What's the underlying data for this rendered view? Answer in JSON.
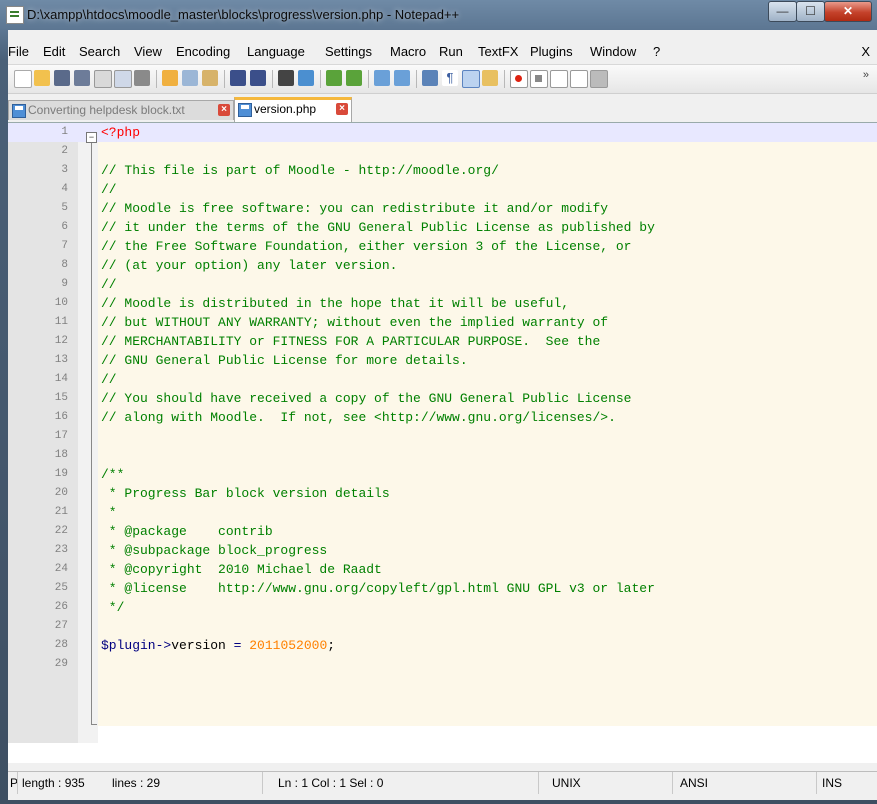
{
  "window": {
    "title": "D:\\xampp\\htdocs\\moodle_master\\blocks\\progress\\version.php - Notepad++",
    "min_glyph": "—",
    "max_glyph": "☐",
    "close_glyph": "✕"
  },
  "menu": {
    "items": [
      "File",
      "Edit",
      "Search",
      "View",
      "Encoding",
      "Language",
      "Settings",
      "Macro",
      "Run",
      "TextFX",
      "Plugins",
      "Window",
      "?"
    ],
    "close_glyph": "X"
  },
  "toolbar": {
    "icons": [
      "new-file-icon",
      "open-file-icon",
      "save-icon",
      "save-all-icon",
      "close-icon",
      "close-all-icon",
      "print-icon",
      "cut-icon",
      "copy-icon",
      "paste-icon",
      "undo-icon",
      "redo-icon",
      "find-icon",
      "replace-icon",
      "zoom-in-icon",
      "zoom-out-icon",
      "sync-v-icon",
      "sync-h-icon",
      "word-wrap-icon",
      "show-all-chars-icon",
      "indent-guide-icon",
      "doc-map-icon",
      "record-macro-icon",
      "stop-macro-icon",
      "play-macro-icon",
      "run-macro-multiple-icon",
      "save-macro-icon"
    ],
    "more_glyph": "»"
  },
  "tabs": [
    {
      "label": "Converting helpdesk block.txt",
      "active": false
    },
    {
      "label": "version.php",
      "active": true
    }
  ],
  "editor": {
    "lines": [
      {
        "n": "1",
        "t": "<?php"
      },
      {
        "n": "2",
        "t": ""
      },
      {
        "n": "3",
        "t": "// This file is part of Moodle - http://moodle.org/"
      },
      {
        "n": "4",
        "t": "//"
      },
      {
        "n": "5",
        "t": "// Moodle is free software: you can redistribute it and/or modify"
      },
      {
        "n": "6",
        "t": "// it under the terms of the GNU General Public License as published by"
      },
      {
        "n": "7",
        "t": "// the Free Software Foundation, either version 3 of the License, or"
      },
      {
        "n": "8",
        "t": "// (at your option) any later version."
      },
      {
        "n": "9",
        "t": "//"
      },
      {
        "n": "10",
        "t": "// Moodle is distributed in the hope that it will be useful,"
      },
      {
        "n": "11",
        "t": "// but WITHOUT ANY WARRANTY; without even the implied warranty of"
      },
      {
        "n": "12",
        "t": "// MERCHANTABILITY or FITNESS FOR A PARTICULAR PURPOSE.  See the"
      },
      {
        "n": "13",
        "t": "// GNU General Public License for more details."
      },
      {
        "n": "14",
        "t": "//"
      },
      {
        "n": "15",
        "t": "// You should have received a copy of the GNU General Public License"
      },
      {
        "n": "16",
        "t": "// along with Moodle.  If not, see <http://www.gnu.org/licenses/>."
      },
      {
        "n": "17",
        "t": ""
      },
      {
        "n": "18",
        "t": ""
      },
      {
        "n": "19",
        "t": "/**"
      },
      {
        "n": "20",
        "t": " * Progress Bar block version details"
      },
      {
        "n": "21",
        "t": " *"
      },
      {
        "n": "22",
        "t": " * @package    contrib"
      },
      {
        "n": "23",
        "t": " * @subpackage block_progress"
      },
      {
        "n": "24",
        "t": " * @copyright  2010 Michael de Raadt"
      },
      {
        "n": "25",
        "t": " * @license    http://www.gnu.org/copyleft/gpl.html GNU GPL v3 or later"
      },
      {
        "n": "26",
        "t": " */"
      },
      {
        "n": "27",
        "t": ""
      },
      {
        "n": "28",
        "t": "$plugin->version = 2011052000;"
      },
      {
        "n": "29",
        "t": ""
      }
    ],
    "last_line_parts": {
      "var": "$plugin",
      "arrow": "->",
      "prop": "version",
      "eq": " = ",
      "num": "2011052000",
      "semi": ";"
    }
  },
  "status": {
    "type": "PH",
    "length": "length : 935",
    "lines": "lines : 29",
    "position": "Ln : 1    Col : 1    Sel : 0",
    "eol": "UNIX",
    "encoding": "ANSI",
    "mode": "INS"
  },
  "colors": {
    "comment": "#008000",
    "php_tag": "#ff0000",
    "number": "#ff8000",
    "current_line": "#e8e8ff",
    "active_tab_accent": "#f5b83d"
  }
}
